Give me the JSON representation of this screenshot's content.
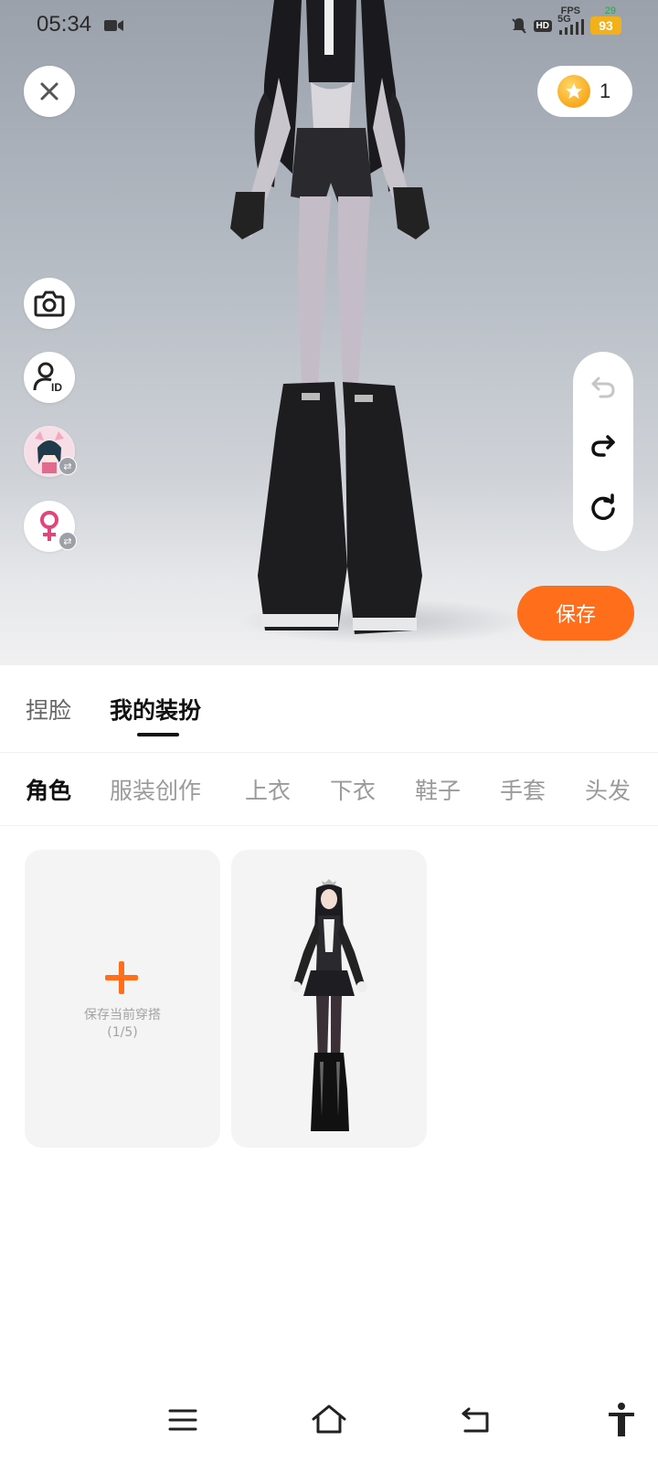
{
  "status_bar": {
    "time": "05:34",
    "fps_label": "FPS",
    "fps_value": "29",
    "network": "5G",
    "hd": "HD",
    "battery": "93",
    "icons": [
      "video-camera-icon",
      "mute-bell-icon",
      "hd-icon",
      "signal-icon",
      "battery-icon"
    ]
  },
  "viewer": {
    "coins": "1",
    "save_label": "保存",
    "left_tools": [
      "camera-icon",
      "avatar-id-icon",
      "character-swap",
      "gender-swap"
    ],
    "right_tools": [
      "undo-icon",
      "redo-icon",
      "reset-icon"
    ]
  },
  "top_tabs": [
    {
      "label": "捏脸",
      "active": false
    },
    {
      "label": "我的装扮",
      "active": true
    }
  ],
  "category_tabs": [
    {
      "label": "角色",
      "active": true
    },
    {
      "label": "服装创作",
      "active": false
    },
    {
      "label": "上衣",
      "active": false
    },
    {
      "label": "下衣",
      "active": false
    },
    {
      "label": "鞋子",
      "active": false
    },
    {
      "label": "手套",
      "active": false
    },
    {
      "label": "头发",
      "active": false
    }
  ],
  "outfits": {
    "add_label": "保存当前穿搭",
    "count": "(1/5)"
  },
  "colors": {
    "accent": "#ff6e1a",
    "battery": "#f2b118",
    "gender": "#e0457b"
  },
  "nav_icons": [
    "menu-icon",
    "home-icon",
    "back-icon",
    "accessibility-icon"
  ]
}
